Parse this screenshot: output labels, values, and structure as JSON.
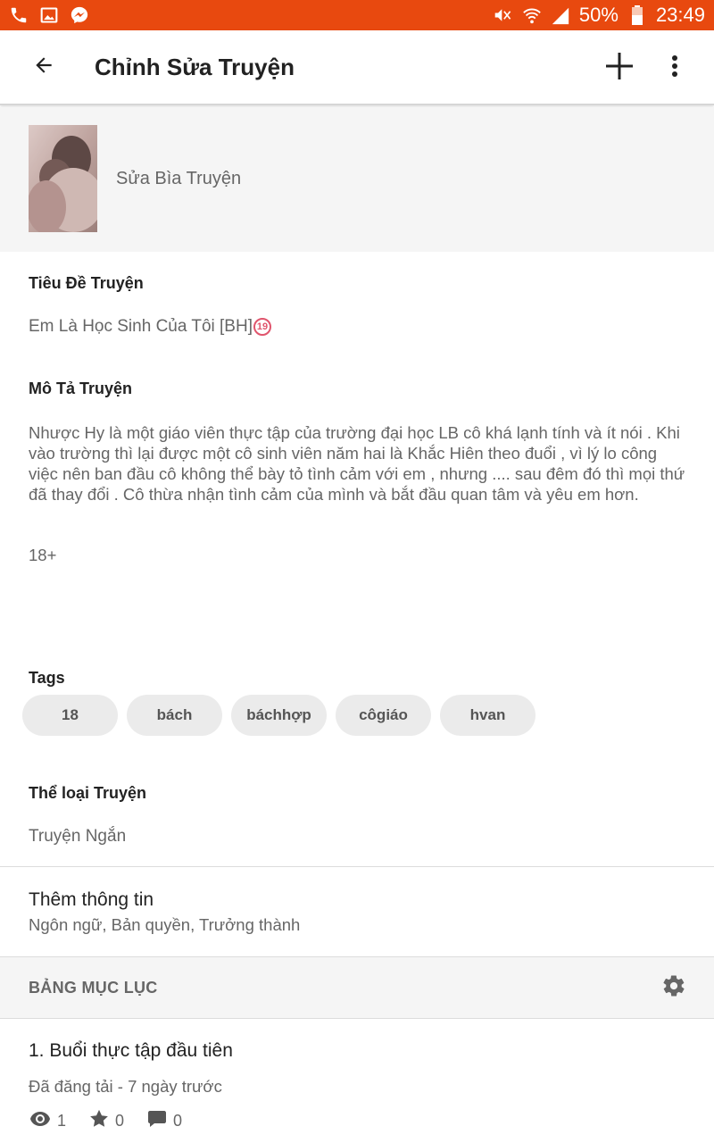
{
  "status_bar": {
    "battery": "50%",
    "time": "23:49",
    "left_icons": [
      "phone-icon",
      "gallery-icon",
      "messenger-icon"
    ],
    "right_icons": [
      "mute-icon",
      "wifi-icon",
      "signal-icon",
      "battery-icon"
    ]
  },
  "app_bar": {
    "title": "Chỉnh Sửa Truyện",
    "icons": [
      "back-arrow-icon",
      "plus-icon",
      "more-vert-icon"
    ]
  },
  "cover": {
    "label": "Sửa Bìa Truyện"
  },
  "story": {
    "title_label": "Tiêu Đề Truyện",
    "title_value": "Em Là Học Sinh Của Tôi [BH]",
    "title_badge": "19",
    "description_label": "Mô Tả Truyện",
    "description": "Nhược Hy là một giáo viên thực tập của trường đại học LB cô khá lạnh tính và ít nói . Khi vào trường thì lại được một cô sinh viên năm hai là Khắc Hiên theo đuổi , vì lý lo công việc nên ban đầu cô không thể bày tỏ tình cảm với em , nhưng .... sau đêm đó thì mọi thứ đã thay đổi . Cô thừa nhận tình cảm của mình và bắt đầu quan tâm và yêu em hơn.",
    "description_extra": "18+",
    "tags_label": "Tags",
    "tags": [
      "18",
      "bách",
      "báchhợp",
      "côgiáo",
      "hvan"
    ],
    "category_label": "Thể loại Truyện",
    "category_value": "Truyện Ngắn"
  },
  "more_info": {
    "title": "Thêm thông tin",
    "subtitle": "Ngôn ngữ, Bản quyền, Trưởng thành"
  },
  "toc": {
    "header": "BẢNG MỤC LỤC",
    "chapters": [
      {
        "title": "1. Buổi thực tập đầu tiên",
        "status": "Đã đăng tải - 7 ngày trước",
        "views": "1",
        "votes": "0",
        "comments": "0"
      }
    ]
  },
  "colors": {
    "accent": "#e8490f",
    "text_primary": "#222222",
    "text_secondary": "#666666",
    "section_bg": "#f5f5f5",
    "tag_bg": "#ebebeb",
    "badge": "#e0556d"
  }
}
